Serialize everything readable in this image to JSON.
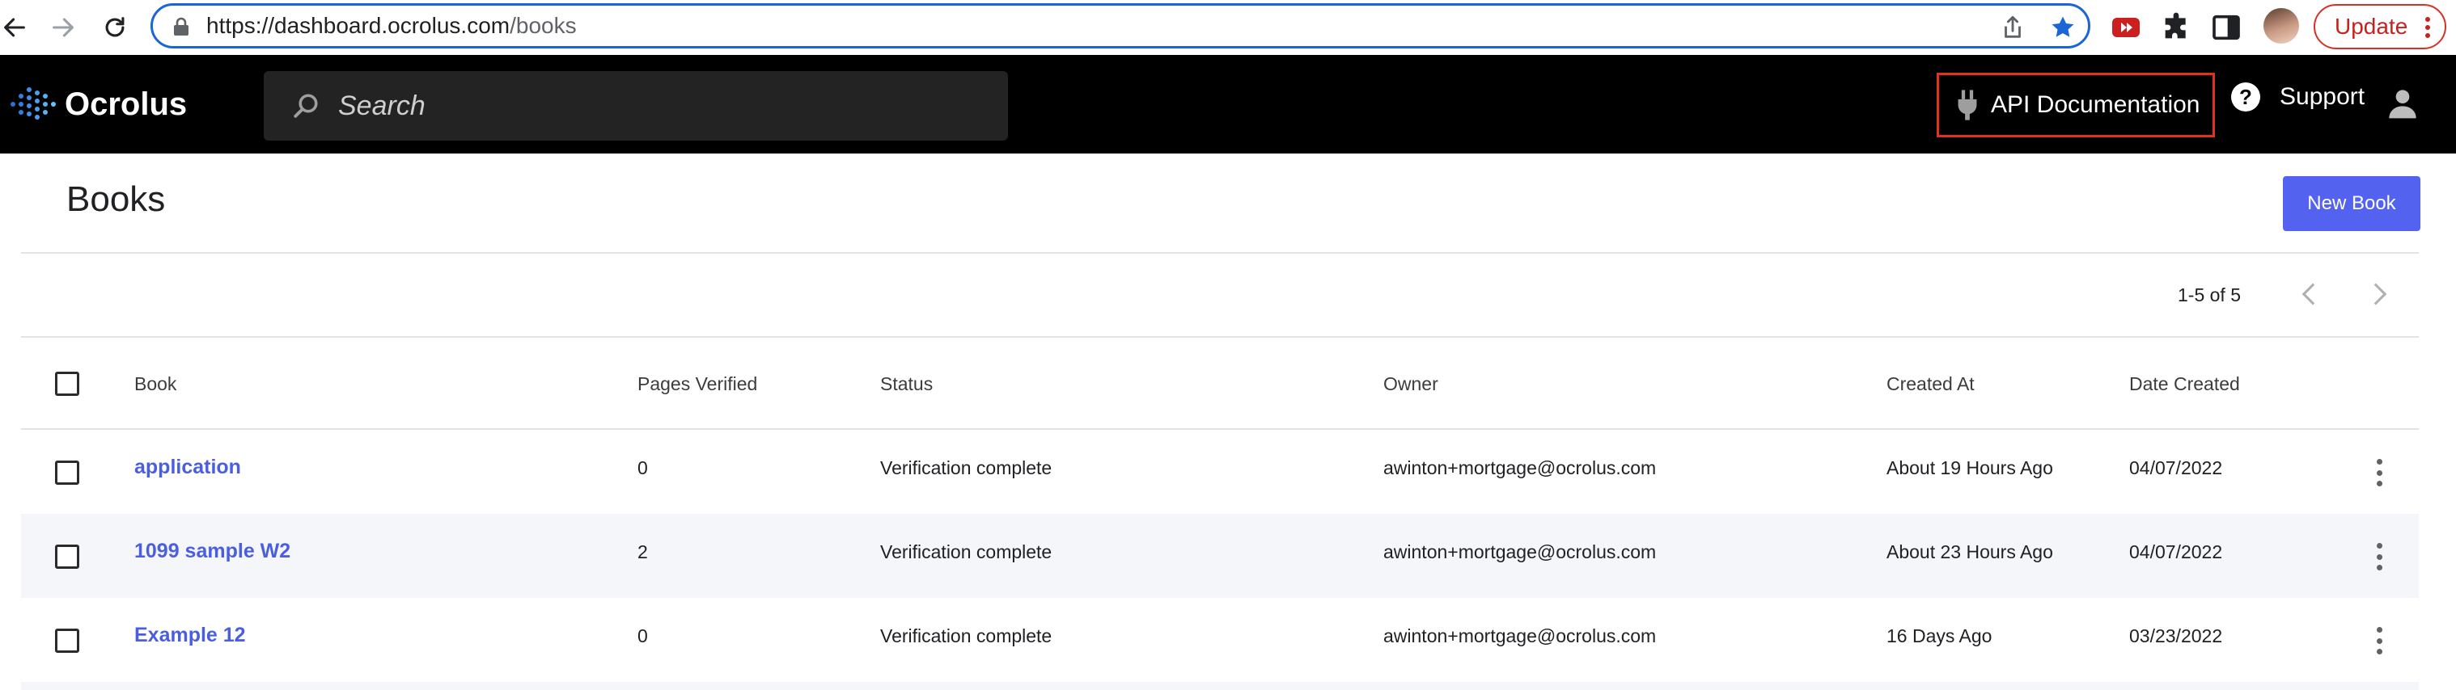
{
  "browser": {
    "url_host": "https://dashboard.ocrolus.com",
    "url_path": "/books",
    "update_label": "Update"
  },
  "header": {
    "logo_text": "Ocrolus",
    "search_placeholder": "Search",
    "api_doc_label": "API Documentation",
    "support_label": "Support"
  },
  "page": {
    "title": "Books",
    "new_book_label": "New Book",
    "pagination": "1-5 of 5"
  },
  "table": {
    "columns": [
      "Book",
      "Pages Verified",
      "Status",
      "Owner",
      "Created At",
      "Date Created"
    ],
    "rows": [
      {
        "book": "application",
        "pages_verified": "0",
        "status": "Verification complete",
        "owner": "awinton+mortgage@ocrolus.com",
        "created_at": "About 19 Hours Ago",
        "date_created": "04/07/2022"
      },
      {
        "book": "1099 sample W2",
        "pages_verified": "2",
        "status": "Verification complete",
        "owner": "awinton+mortgage@ocrolus.com",
        "created_at": "About 23 Hours Ago",
        "date_created": "04/07/2022"
      },
      {
        "book": "Example 12",
        "pages_verified": "0",
        "status": "Verification complete",
        "owner": "awinton+mortgage@ocrolus.com",
        "created_at": "16 Days Ago",
        "date_created": "03/23/2022"
      }
    ]
  },
  "colors": {
    "accent": "#5462f0",
    "link": "#4a5fe0",
    "header_bg": "#000000",
    "highlight_border": "#e0321f"
  }
}
